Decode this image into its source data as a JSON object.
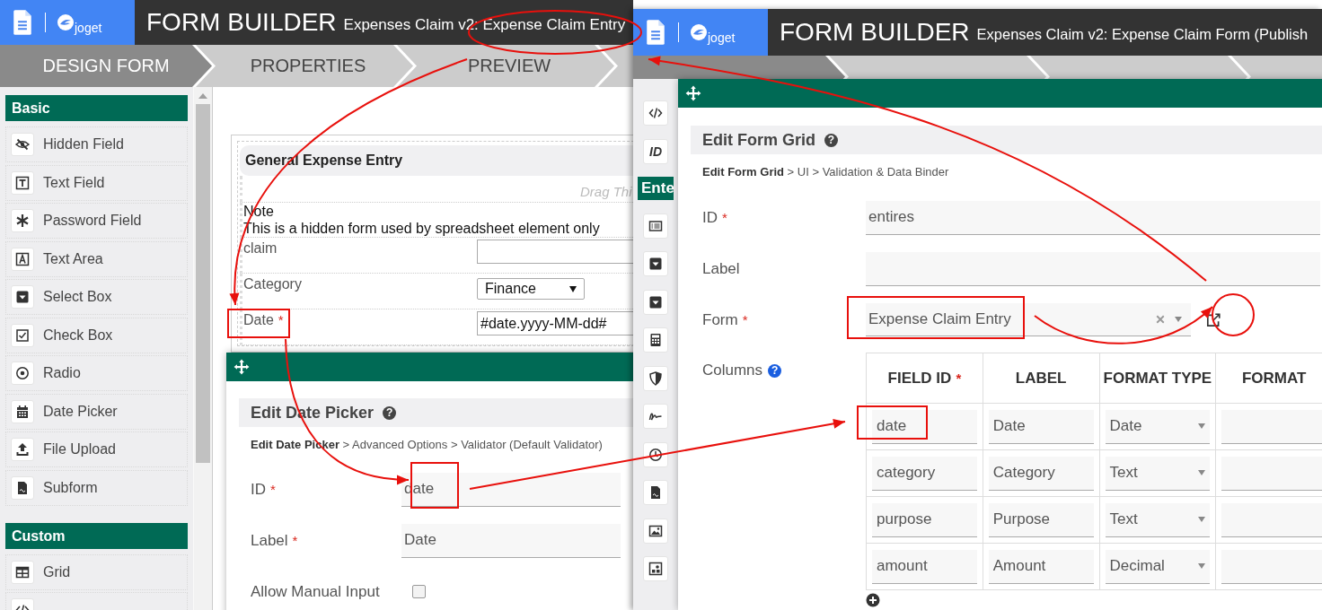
{
  "left_window": {
    "logo_text": "joget",
    "title": "FORM BUILDER",
    "subtitle": "Expenses Claim v2: Expense Claim Entry",
    "steps": [
      {
        "label": "DESIGN FORM",
        "selected": true
      },
      {
        "label": "PROPERTIES",
        "selected": false
      },
      {
        "label": "PREVIEW",
        "selected": false
      }
    ],
    "palette": [
      {
        "heading": "Basic",
        "items": [
          {
            "label": "Hidden Field"
          },
          {
            "label": "Text Field"
          },
          {
            "label": "Password Field"
          },
          {
            "label": "Text Area"
          },
          {
            "label": "Select Box"
          },
          {
            "label": "Check Box"
          },
          {
            "label": "Radio"
          },
          {
            "label": "Date Picker"
          },
          {
            "label": "File Upload"
          },
          {
            "label": "Subform"
          }
        ]
      },
      {
        "heading": "Custom",
        "items": [
          {
            "label": "Grid"
          }
        ]
      }
    ],
    "form": {
      "title": "General Expense Entry",
      "drag_hint": "Drag Thi",
      "note": {
        "title": "Note",
        "text": "This is a hidden form used by spreadsheet element only"
      },
      "fields": [
        {
          "kind": "text",
          "label": "claim"
        },
        {
          "kind": "select",
          "label": "Category",
          "value": "Finance"
        },
        {
          "kind": "text",
          "label": "Date",
          "required_mark": "*",
          "value": "#date.yyyy-MM-dd#"
        }
      ]
    },
    "dialog": {
      "title": "Edit Date Picker",
      "help": "?",
      "breadcrumb": "**Edit Date Picker** > Advanced Options > Validator (Default Validator)",
      "fields": [
        {
          "kind": "text",
          "label": "ID",
          "required_mark": "*",
          "value": "date"
        },
        {
          "kind": "text",
          "label": "Label",
          "required_mark": "*",
          "value": "Date"
        },
        {
          "kind": "checkbox",
          "label": "Allow Manual Input",
          "checked": false
        }
      ]
    }
  },
  "right_window": {
    "logo_text": "joget",
    "title": "FORM BUILDER",
    "subtitle": "Expenses Claim v2: Expense Claim Form (Publish",
    "steps": [
      {
        "selected": true
      },
      {
        "selected": false
      },
      {
        "selected": false
      }
    ],
    "toolbox": {
      "id_label": "ID",
      "section_heading": "Ente"
    },
    "dialog": {
      "title": "Edit Form Grid",
      "help": "?",
      "breadcrumb": "**Edit Form Grid** > UI > Validation & Data Binder",
      "fields": [
        {
          "kind": "text",
          "label": "ID",
          "required_mark": "*",
          "value": "entires"
        },
        {
          "kind": "text",
          "label": "Label"
        },
        {
          "kind": "lookup",
          "label": "Form",
          "required_mark": "*",
          "value": "Expense Claim Entry"
        },
        {
          "kind": "grid",
          "label": "Columns",
          "help": "?",
          "columns": [
            {
              "label": "FIELD ID",
              "required_mark": "*"
            },
            {
              "label": "LABEL"
            },
            {
              "label": "FORMAT TYPE"
            },
            {
              "label": "FORMAT"
            }
          ],
          "rows": [
            {
              "field_id": "date",
              "label": "Date",
              "format_type": "Date"
            },
            {
              "field_id": "category",
              "label": "Category",
              "format_type": "Text"
            },
            {
              "field_id": "purpose",
              "label": "Purpose",
              "format_type": "Text"
            },
            {
              "field_id": "amount",
              "label": "Amount",
              "format_type": "Decimal"
            }
          ]
        }
      ]
    }
  }
}
